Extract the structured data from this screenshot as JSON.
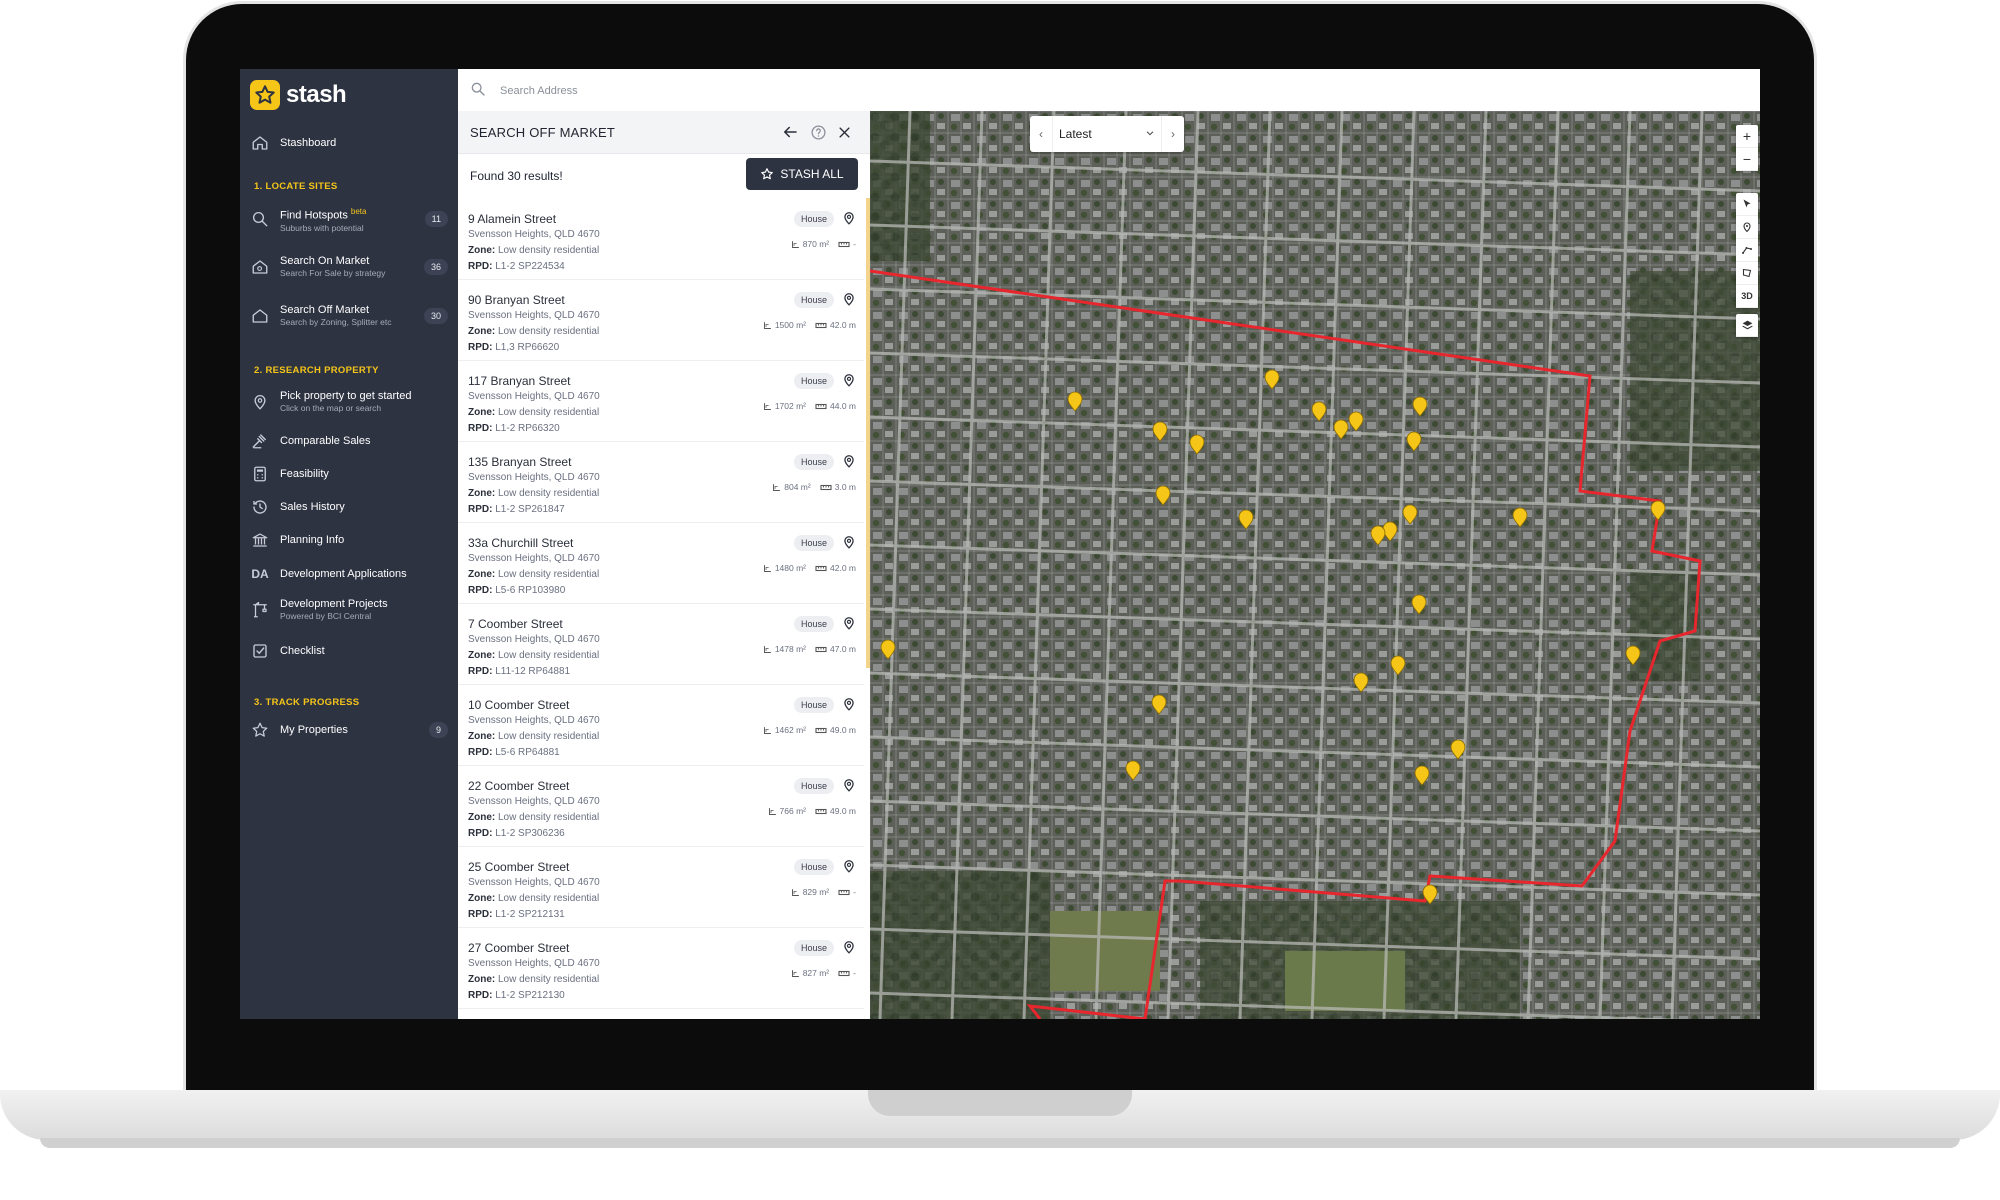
{
  "app": {
    "name": "stash"
  },
  "search": {
    "placeholder": "Search Address"
  },
  "sidebar": {
    "stashboard": "Stashboard",
    "sections": {
      "locate": "1. LOCATE SITES",
      "research": "2. RESEARCH PROPERTY",
      "track": "3. TRACK PROGRESS"
    },
    "items": {
      "hotspots": {
        "label": "Find Hotspots",
        "beta": "beta",
        "sub": "Suburbs with potential",
        "count": "11"
      },
      "on_market": {
        "label": "Search On Market",
        "sub": "Search For Sale by strategy",
        "count": "36"
      },
      "off_market": {
        "label": "Search Off Market",
        "sub": "Search by Zoning, Splitter etc",
        "count": "30"
      },
      "pick": {
        "label": "Pick property to get started",
        "sub": "Click on the map or search"
      },
      "comparable": {
        "label": "Comparable Sales"
      },
      "feasibility": {
        "label": "Feasibility"
      },
      "sales_history": {
        "label": "Sales History"
      },
      "planning": {
        "label": "Planning Info"
      },
      "dev_apps": {
        "label": "Development Applications",
        "icon_text": "DA"
      },
      "dev_projects": {
        "label": "Development Projects",
        "sub": "Powered by BCI Central"
      },
      "checklist": {
        "label": "Checklist"
      },
      "my_properties": {
        "label": "My Properties",
        "count": "9"
      }
    }
  },
  "panel": {
    "title": "SEARCH OFF MARKET",
    "found": "Found 30 results!",
    "stash_all": "STASH ALL",
    "zone_label": "Zone:",
    "rpd_label": "RPD:",
    "results": [
      {
        "address": "9 Alamein Street",
        "suburb": "Svensson Heights, QLD 4670",
        "zone": "Low density residential",
        "rpd": "L1-2 SP224534",
        "type": "House",
        "area": "870 m²",
        "frontage": "-"
      },
      {
        "address": "90 Branyan Street",
        "suburb": "Svensson Heights, QLD 4670",
        "zone": "Low density residential",
        "rpd": "L1,3 RP66620",
        "type": "House",
        "area": "1500 m²",
        "frontage": "42.0 m"
      },
      {
        "address": "117 Branyan Street",
        "suburb": "Svensson Heights, QLD 4670",
        "zone": "Low density residential",
        "rpd": "L1-2 RP66320",
        "type": "House",
        "area": "1702 m²",
        "frontage": "44.0 m"
      },
      {
        "address": "135 Branyan Street",
        "suburb": "Svensson Heights, QLD 4670",
        "zone": "Low density residential",
        "rpd": "L1-2 SP261847",
        "type": "House",
        "area": "804 m²",
        "frontage": "3.0 m"
      },
      {
        "address": "33a Churchill Street",
        "suburb": "Svensson Heights, QLD 4670",
        "zone": "Low density residential",
        "rpd": "L5-6 RP103980",
        "type": "House",
        "area": "1480 m²",
        "frontage": "42.0 m"
      },
      {
        "address": "7 Coomber Street",
        "suburb": "Svensson Heights, QLD 4670",
        "zone": "Low density residential",
        "rpd": "L11-12 RP64881",
        "type": "House",
        "area": "1478 m²",
        "frontage": "47.0 m"
      },
      {
        "address": "10 Coomber Street",
        "suburb": "Svensson Heights, QLD 4670",
        "zone": "Low density residential",
        "rpd": "L5-6 RP64881",
        "type": "House",
        "area": "1462 m²",
        "frontage": "49.0 m"
      },
      {
        "address": "22 Coomber Street",
        "suburb": "Svensson Heights, QLD 4670",
        "zone": "Low density residential",
        "rpd": "L1-2 SP306236",
        "type": "House",
        "area": "766 m²",
        "frontage": "49.0 m"
      },
      {
        "address": "25 Coomber Street",
        "suburb": "Svensson Heights, QLD 4670",
        "zone": "Low density residential",
        "rpd": "L1-2 SP212131",
        "type": "House",
        "area": "829 m²",
        "frontage": "-"
      },
      {
        "address": "27 Coomber Street",
        "suburb": "Svensson Heights, QLD 4670",
        "zone": "Low density residential",
        "rpd": "L1-2 SP212130",
        "type": "House",
        "area": "827 m²",
        "frontage": "-"
      }
    ]
  },
  "map": {
    "date_value": "Latest",
    "controls": {
      "zoom_in": "+",
      "zoom_out": "−",
      "three_d": "3D"
    },
    "colors": {
      "boundary": "#e8262d",
      "marker": "#f5c518"
    }
  }
}
